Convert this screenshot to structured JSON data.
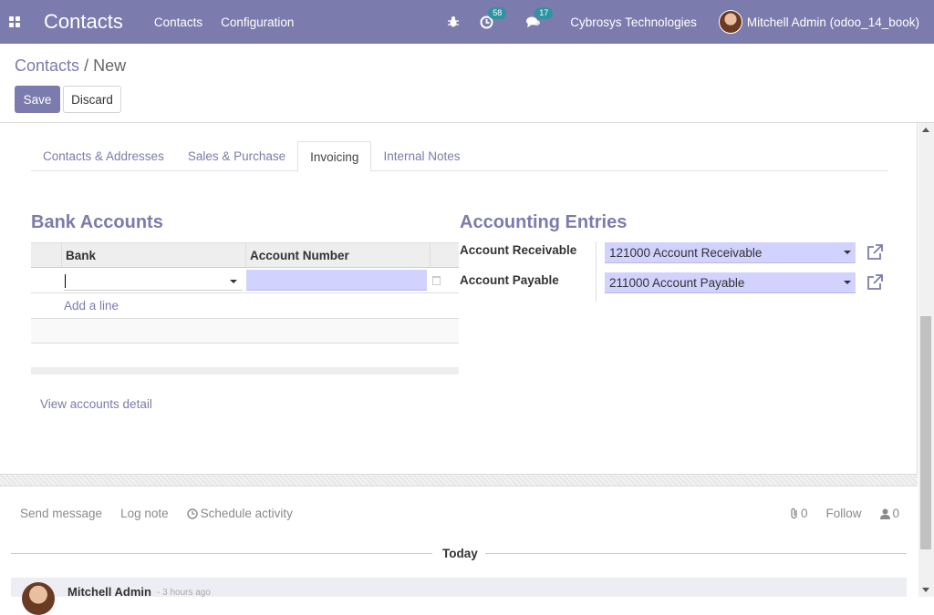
{
  "navbar": {
    "app_title": "Contacts",
    "menu": [
      "Contacts",
      "Configuration"
    ],
    "activity_count": "58",
    "message_count": "17",
    "company": "Cybrosys Technologies",
    "user": "Mitchell Admin (odoo_14_book)",
    "color": "#7c7bad"
  },
  "breadcrumb": {
    "parent": "Contacts",
    "separator": "/",
    "current": "New"
  },
  "buttons": {
    "save": "Save",
    "discard": "Discard"
  },
  "tabs": [
    "Contacts & Addresses",
    "Sales & Purchase",
    "Invoicing",
    "Internal Notes"
  ],
  "active_tab": "Invoicing",
  "bank_accounts": {
    "title": "Bank Accounts",
    "columns": [
      "Bank",
      "Account Number"
    ],
    "add_line": "Add a line",
    "view_detail": "View accounts detail"
  },
  "accounting_entries": {
    "title": "Accounting Entries",
    "receivable_label": "Account Receivable",
    "receivable_value": "121000 Account Receivable",
    "payable_label": "Account Payable",
    "payable_value": "211000 Account Payable"
  },
  "chatter": {
    "send_message": "Send message",
    "log_note": "Log note",
    "schedule_activity": "Schedule activity",
    "attachments": "0",
    "follow": "Follow",
    "followers": "0",
    "today": "Today",
    "author": "Mitchell Admin",
    "time": "- 3 hours ago"
  }
}
